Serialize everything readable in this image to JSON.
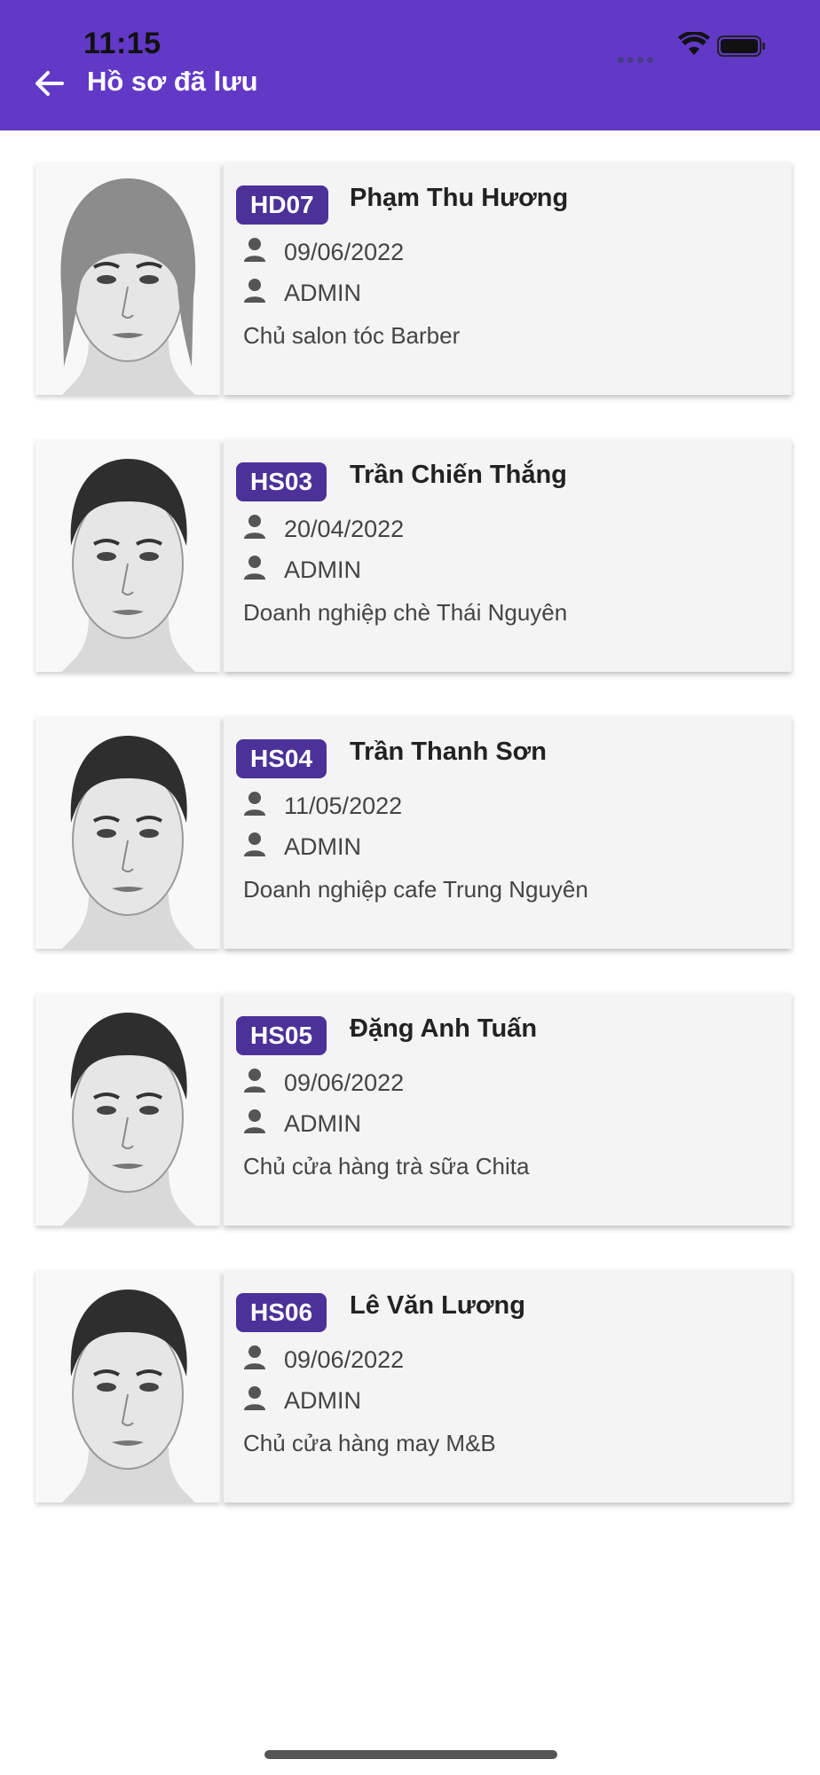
{
  "status_bar": {
    "time": "11:15"
  },
  "header": {
    "title": "Hồ sơ đã lưu",
    "back_icon": "arrow-left-icon",
    "bg_color": "#6139c6"
  },
  "profiles": [
    {
      "code": "HD07",
      "name": "Phạm Thu Hương",
      "date": "09/06/2022",
      "user": "ADMIN",
      "description": "Chủ salon tóc Barber",
      "hair": "long"
    },
    {
      "code": "HS03",
      "name": "Trần Chiến Thắng",
      "date": "20/04/2022",
      "user": "ADMIN",
      "description": "Doanh nghiệp chè Thái Nguyên",
      "hair": "short"
    },
    {
      "code": "HS04",
      "name": "Trần Thanh Sơn",
      "date": "11/05/2022",
      "user": "ADMIN",
      "description": "Doanh nghiệp cafe Trung Nguyên",
      "hair": "short"
    },
    {
      "code": "HS05",
      "name": "Đặng Anh Tuấn",
      "date": "09/06/2022",
      "user": "ADMIN",
      "description": "Chủ cửa hàng trà sữa Chita",
      "hair": "short"
    },
    {
      "code": "HS06",
      "name": "Lê Văn Lương",
      "date": "09/06/2022",
      "user": "ADMIN",
      "description": "Chủ cửa hàng may M&B",
      "hair": "short"
    }
  ],
  "colors": {
    "badge": "#4c3199",
    "card_bg": "#f4f4f4"
  }
}
